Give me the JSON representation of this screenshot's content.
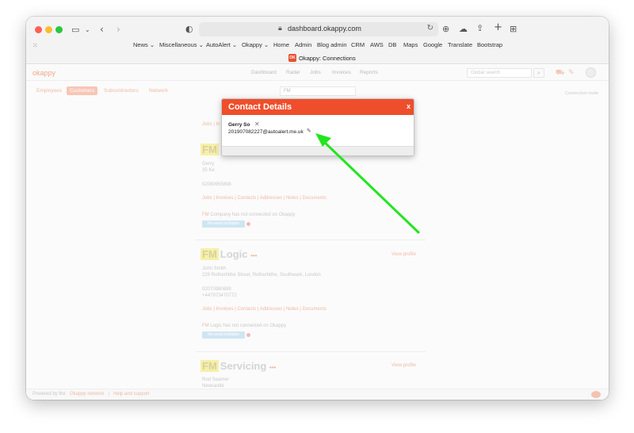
{
  "browser": {
    "url": "dashboard.okappy.com",
    "tab_title": "Okappy: Connections",
    "tab_favicon_text": "OK",
    "bookmarks": [
      "News ⌄",
      "Miscellaneous ⌄",
      "AutoAlert ⌄",
      "Okappy ⌄",
      "Home",
      "Admin",
      "Blog admin",
      "CRM",
      "AWS",
      "DB",
      "Maps",
      "Google",
      "Translate",
      "Bootstrap"
    ]
  },
  "app": {
    "brand": "okappy",
    "nav": [
      "Dashboard",
      "Radar",
      "Jobs",
      "Invoices",
      "Reports"
    ],
    "global_search_placeholder": "Global search",
    "subtabs": [
      "Employees",
      "Customers",
      "Subcontractors",
      "Network"
    ],
    "active_subtab": "Customers",
    "connection_invite": "Connection invite",
    "search_value": "FM"
  },
  "cards": [
    {
      "top_links": "Jobs | In",
      "name_prefix": "FM",
      "contact": "Gerry",
      "address": "35 Ke",
      "phone": "02080955698",
      "links": "Jobs | Invoices | Contacts | Addresses | Notes | Documents",
      "status_prefix": "FM",
      "status": " Company has not connected on Okappy",
      "button": "Re-send invitation"
    },
    {
      "name_prefix": "FM",
      "name": "Logic",
      "view_profile": "View profile",
      "contact": "John Smith",
      "address": "229 Rotherhithe Street, Rotherhithe, Southwark, London",
      "phone": "02070980698",
      "mobile": "+447973470772",
      "links": "Jobs | Invoices | Contacts | Addresses | Notes | Documents",
      "status_prefix": "FM",
      "status": " Logic has not connected on Okappy",
      "button": "Re-send invitation"
    },
    {
      "name_prefix": "FM",
      "name": "Servicing",
      "view_profile": "View profile",
      "contact": "Rod Seamer",
      "address": "Newcastle",
      "mobile": "07974777332"
    }
  ],
  "footer": {
    "powered_by": "Powered by the",
    "network": "Okappy network",
    "separator": "|",
    "help": "Help and support"
  },
  "modal": {
    "title": "Contact Details",
    "close": "x",
    "contact_name": "Gerry So",
    "contact_email": "201907082227@autoalert.me.uk"
  },
  "colors": {
    "modal_header": "#ee4e2b",
    "annotation_arrow": "#22e51f",
    "brand_accent": "#f1a88c"
  }
}
